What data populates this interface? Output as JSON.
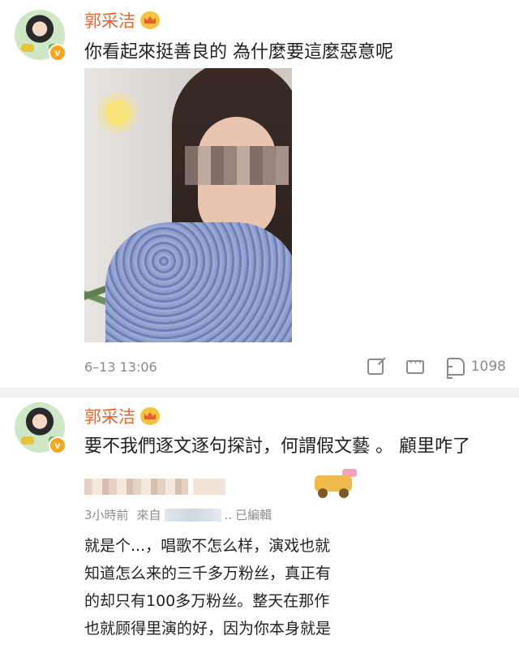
{
  "colors": {
    "username": "#e8622a",
    "meta": "#8a8a8a",
    "verify_badge": "#f4a623"
  },
  "post1": {
    "username": "郭采洁",
    "badge_icon": "crown-icon",
    "text": "你看起來挺善良的 為什麼要這麼惡意呢",
    "timestamp": "6–13 13:06",
    "actions": {
      "share_icon": "share-icon",
      "comment_icon": "comment-icon",
      "like_icon": "thumbs-up-icon",
      "like_count": "1098"
    }
  },
  "post2": {
    "username": "郭采洁",
    "badge_icon": "crown-icon",
    "text": "要不我們逐文逐句探討，何謂假文藝 。 顧里咋了"
  },
  "quoted": {
    "time": "3小時前",
    "from_label": "來自",
    "ellipsis": "..",
    "edited": "已編輯",
    "lines": [
      "就是个...，唱歌不怎么样，演戏也就",
      "知道怎么来的三千多万粉丝，真正有",
      "的却只有100多万粉丝。整天在那作",
      "也就顾得里演的好，因为你本身就是"
    ]
  }
}
